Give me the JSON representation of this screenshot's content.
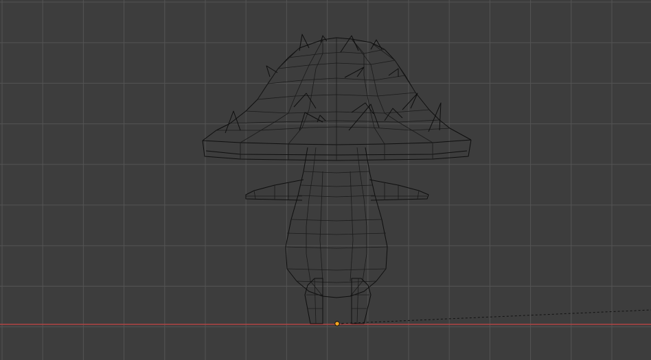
{
  "viewport": {
    "background_color": "#3d3d3d",
    "grid_color": "#545454",
    "x_axis_color": "#b14444",
    "wire_color": "#0e0e0e",
    "origin_color": "#f5a623",
    "object": "mushroom-character-wireframe",
    "view": "front-orthographic"
  }
}
